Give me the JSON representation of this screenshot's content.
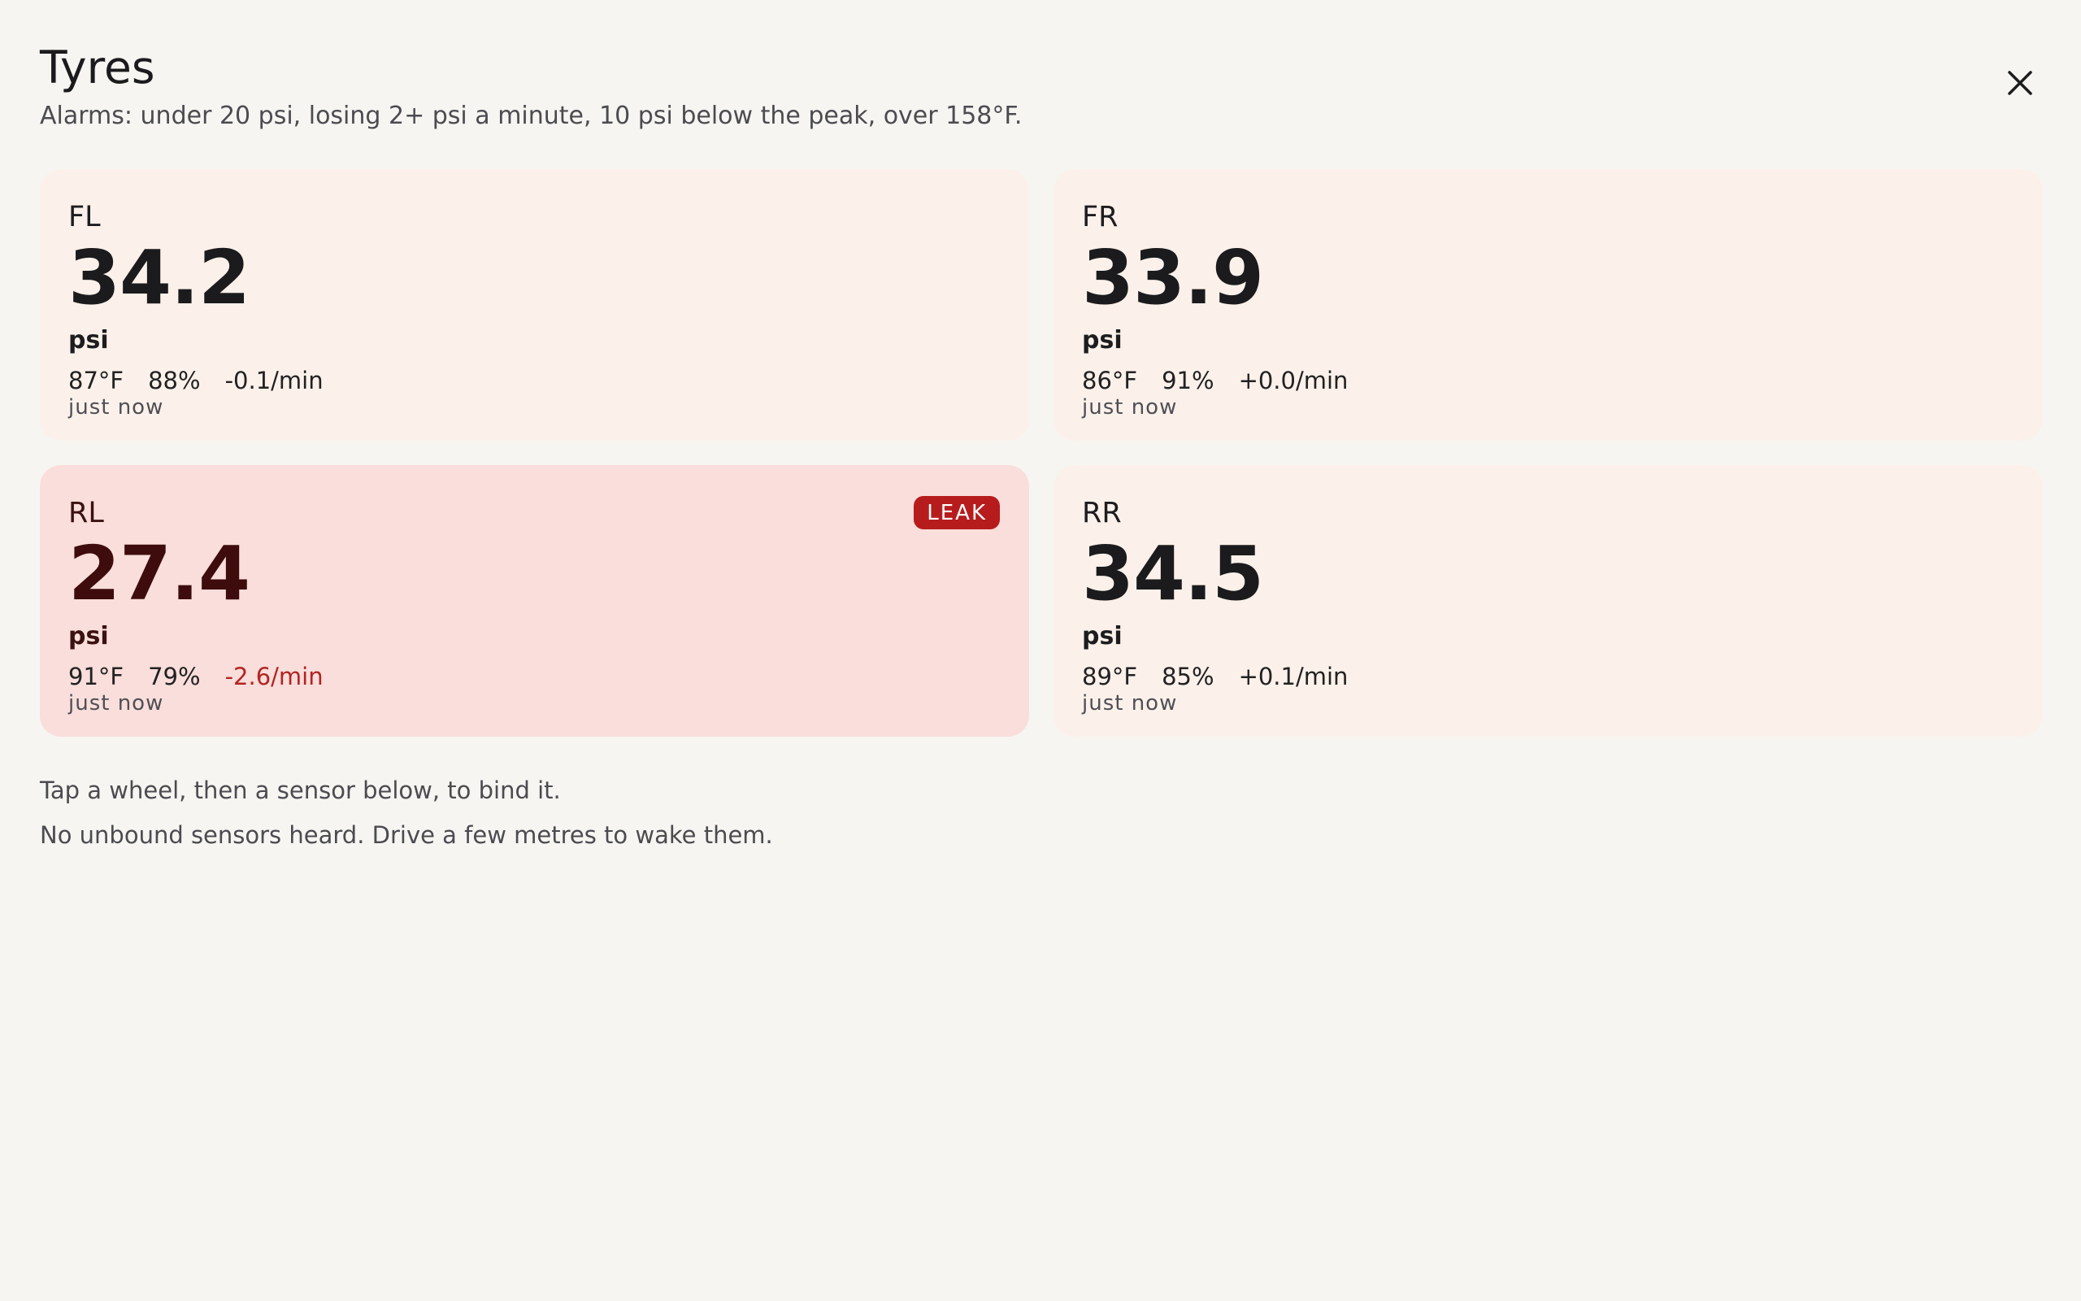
{
  "header": {
    "title": "Tyres",
    "subtitle": "Alarms: under 20 psi, losing 2+ psi a minute, 10 psi below the peak, over 158°F."
  },
  "close_icon": "close-icon",
  "wheels": [
    {
      "position": "FL",
      "pressure": "34.2",
      "unit": "psi",
      "temp": "87°F",
      "battery": "88%",
      "rate": "-0.1/min",
      "updated": "just now",
      "alert": false
    },
    {
      "position": "FR",
      "pressure": "33.9",
      "unit": "psi",
      "temp": "86°F",
      "battery": "91%",
      "rate": "+0.0/min",
      "updated": "just now",
      "alert": false
    },
    {
      "position": "RL",
      "pressure": "27.4",
      "unit": "psi",
      "temp": "91°F",
      "battery": "79%",
      "rate": "-2.6/min",
      "updated": "just now",
      "alert": true,
      "badge": "LEAK"
    },
    {
      "position": "RR",
      "pressure": "34.5",
      "unit": "psi",
      "temp": "89°F",
      "battery": "85%",
      "rate": "+0.1/min",
      "updated": "just now",
      "alert": false
    }
  ],
  "notes": {
    "bind_hint": "Tap a wheel, then a sensor below, to bind it.",
    "no_sensors": "No unbound sensors heard. Drive a few metres to wake them."
  },
  "colors": {
    "background": "#f6f5f1",
    "card": "#fbf1ea",
    "alert_card": "#f9dedb",
    "alert_red": "#b71c1c",
    "alert_text": "#b42322"
  }
}
